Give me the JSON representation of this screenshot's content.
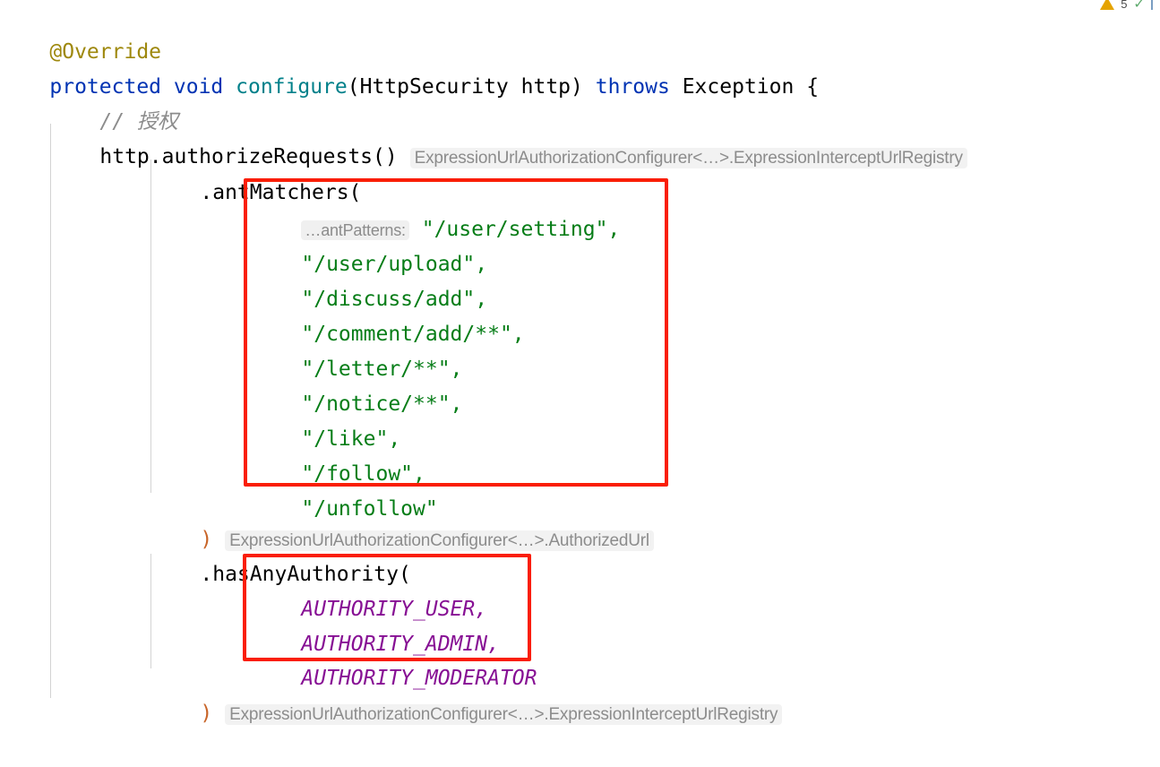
{
  "editor": {
    "language": "java",
    "font_size_px": 23,
    "background": "#ffffff",
    "colors": {
      "annotation": "#9e880d",
      "keyword": "#0033b3",
      "method_declaration": "#00808a",
      "string": "#067d17",
      "static_final_field": "#871094",
      "comment": "#8c8c8c",
      "inlay_hint_text": "#8c8c8c",
      "inlay_hint_background": "#f2f2f2",
      "annotation_box": "#fa1e05",
      "indent_guide": "#d3d3d3",
      "matched_bracket": "#c86428"
    }
  },
  "code": {
    "line1": {
      "annotation": "@Override"
    },
    "line2": {
      "kw_protected": "protected",
      "kw_void": "void",
      "method_name": "configure",
      "paren_open": "(",
      "param_type": "HttpSecurity",
      "param_name": "http",
      "paren_close": ")",
      "kw_throws": "throws",
      "exception_type": "Exception",
      "brace_open": "{"
    },
    "line3": {
      "comment": "// 授权"
    },
    "line4": {
      "expr": "http.authorizeRequests()",
      "type_hint": "ExpressionUrlAuthorizationConfigurer<…>.ExpressionInterceptUrlRegistry"
    },
    "line5": {
      "call": ".antMatchers("
    },
    "ant_patterns": {
      "param_hint": "…antPatterns:",
      "values": [
        "\"/user/setting\",",
        "\"/user/upload\",",
        "\"/discuss/add\",",
        "\"/comment/add/**\",",
        "\"/letter/**\",",
        "\"/notice/**\",",
        "\"/like\",",
        "\"/follow\",",
        "\"/unfollow\""
      ]
    },
    "line15": {
      "paren_close": ")",
      "type_hint": "ExpressionUrlAuthorizationConfigurer<…>.AuthorizedUrl"
    },
    "line16": {
      "call": ".hasAnyAuthority("
    },
    "authorities": {
      "values": [
        "AUTHORITY_USER,",
        "AUTHORITY_ADMIN,",
        "AUTHORITY_MODERATOR"
      ]
    },
    "line20": {
      "paren_close": ")",
      "type_hint": "ExpressionUrlAuthorizationConfigurer<…>.ExpressionInterceptUrlRegistry"
    }
  },
  "inspection_widget": {
    "warning_count": "5",
    "warning_icon": "warning-triangle-icon",
    "status_icon": "green-check-icon"
  },
  "annotations": {
    "box1_label": "ant-patterns-highlight-box",
    "box2_label": "authorities-highlight-box"
  }
}
